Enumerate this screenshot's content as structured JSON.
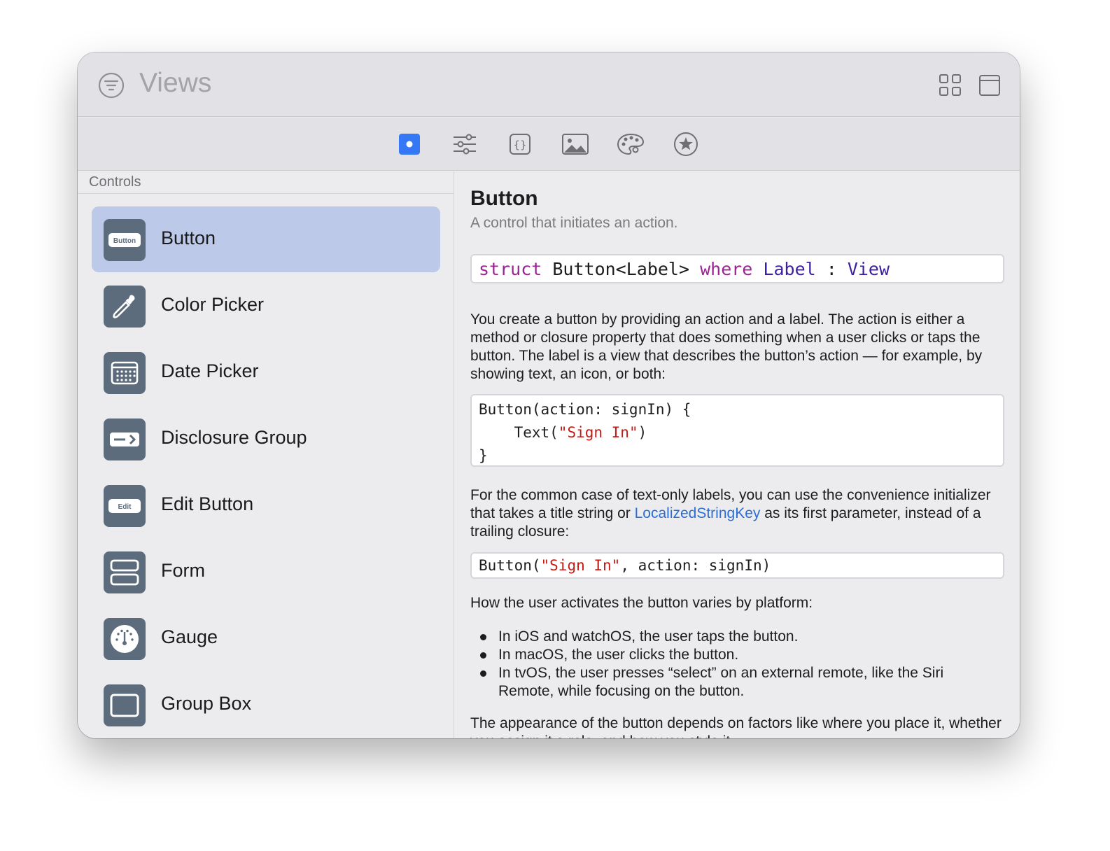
{
  "window": {
    "title": "Views"
  },
  "toolbar": {
    "tabs": [
      {
        "icon": "dot-square-icon",
        "selected": true
      },
      {
        "icon": "sliders-icon",
        "selected": false
      },
      {
        "icon": "curly-braces-icon",
        "selected": false
      },
      {
        "icon": "photo-icon",
        "selected": false
      },
      {
        "icon": "palette-icon",
        "selected": false
      },
      {
        "icon": "star-circle-icon",
        "selected": false
      }
    ]
  },
  "colors": {
    "accent": "#3478f6",
    "selection": "#bdc9e8",
    "icon_bg": "#5d6c7c",
    "link": "#2b6fd6",
    "keyword": "#9b2393",
    "type": "#3d1fa1",
    "string": "#c41a16"
  },
  "sidebar": {
    "section": "Controls",
    "items": [
      {
        "label": "Button",
        "icon": "button-icon",
        "badge": "Button",
        "selected": true
      },
      {
        "label": "Color Picker",
        "icon": "eyedropper-icon",
        "selected": false
      },
      {
        "label": "Date Picker",
        "icon": "calendar-icon",
        "selected": false
      },
      {
        "label": "Disclosure Group",
        "icon": "disclosure-icon",
        "selected": false
      },
      {
        "label": "Edit Button",
        "icon": "edit-button-icon",
        "badge": "Edit",
        "selected": false
      },
      {
        "label": "Form",
        "icon": "form-icon",
        "selected": false
      },
      {
        "label": "Gauge",
        "icon": "gauge-icon",
        "selected": false
      },
      {
        "label": "Group Box",
        "icon": "group-box-icon",
        "selected": false
      }
    ]
  },
  "detail": {
    "title": "Button",
    "subtitle": "A control that initiates an action.",
    "declaration": {
      "kw1": "struct",
      "name": " Button<Label> ",
      "kw2": "where",
      "t1": " Label",
      "sep": " : ",
      "t2": "View"
    },
    "para1": "You create a button by providing an action and a label. The action is either a method or closure property that does something when a user clicks or taps the button. The label is a view that describes the button’s action — for example, by showing text, an icon, or both:",
    "snippet1": {
      "line1": "Button(action: signIn) {",
      "line2_pre": "    Text(",
      "line2_str": "\"Sign In\"",
      "line2_post": ")",
      "line3": "}"
    },
    "para2_a": "For the common case of text-only labels, you can use the convenience initializer that takes a title string or ",
    "para2_link": "LocalizedStringKey",
    "para2_b": " as its first parameter, instead of a trailing closure:",
    "snippet2": {
      "pre": "Button(",
      "str": "\"Sign In\"",
      "post": ", action: signIn)"
    },
    "para3": "How the user activates the button varies by platform:",
    "bullets": [
      "In iOS and watchOS, the user taps the button.",
      "In macOS, the user clicks the button.",
      "In tvOS, the user presses “select” on an external remote, like the Siri Remote, while focusing on the button."
    ],
    "para4": "The appearance of the button depends on factors like where you place it, whether you assign it a role, and how you style it."
  }
}
